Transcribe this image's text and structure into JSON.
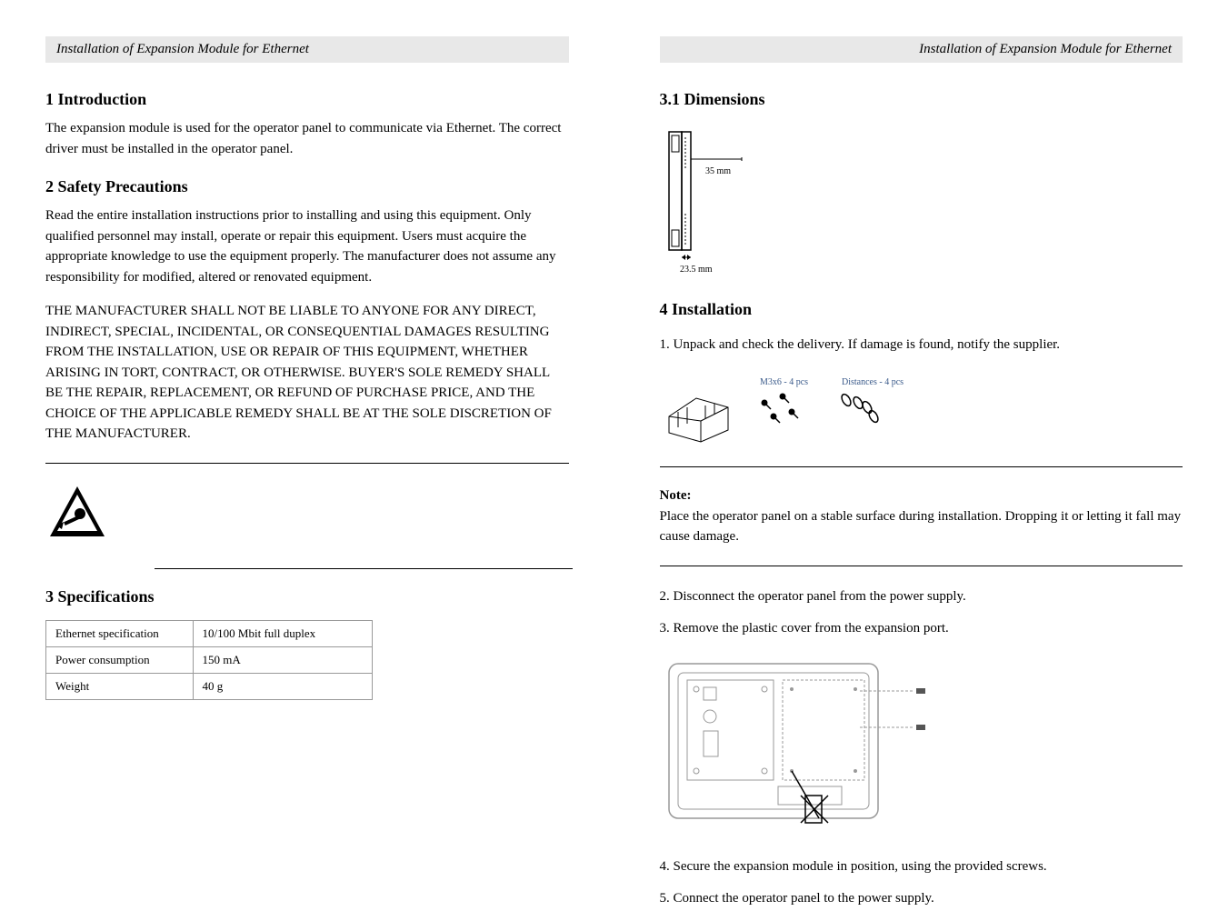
{
  "header": {
    "title": "Installation of Expansion Module for Ethernet"
  },
  "left": {
    "introTitle": "1 Introduction",
    "introText": "The expansion module is used for the operator panel to communicate via Ethernet. The correct driver must be installed in the operator panel.",
    "safetyTitle": "2 Safety Precautions",
    "safetyText": "Read the entire installation instructions prior to installing and using this equipment. Only qualified personnel may install, operate or repair this equipment. Users must acquire the appropriate knowledge to use the equipment properly. The manufacturer does not assume any responsibility for modified, altered or renovated equipment.",
    "disclaimerText": "THE MANUFACTURER SHALL NOT BE LIABLE TO ANYONE FOR ANY DIRECT, INDIRECT, SPECIAL, INCIDENTAL, OR CONSEQUENTIAL DAMAGES RESULTING FROM THE INSTALLATION, USE OR REPAIR OF THIS EQUIPMENT, WHETHER ARISING IN TORT, CONTRACT, OR OTHERWISE. BUYER'S SOLE REMEDY SHALL BE THE REPAIR, REPLACEMENT, OR REFUND OF PURCHASE PRICE, AND THE CHOICE OF THE APPLICABLE REMEDY SHALL BE AT THE SOLE DISCRETION OF THE MANUFACTURER.",
    "specTitle": "3 Specifications",
    "table": {
      "row1": {
        "label": "Ethernet specification",
        "value": "10/100 Mbit full duplex"
      },
      "row2": {
        "label": "Power consumption",
        "value": "150 mA"
      },
      "row3": {
        "label": "Weight",
        "value": "40 g"
      }
    }
  },
  "right": {
    "dimTitle": "3.1 Dimensions",
    "dim1": "35 mm",
    "dim2": "23.5 mm",
    "installTitle": "4 Installation",
    "step1": "1.  Unpack and check the delivery. If damage is found, notify the supplier.",
    "screwLabel": "M3x6 - 4 pcs",
    "distLabel": "Distances - 4 pcs",
    "noteTitle": "Note:",
    "noteText": "Place the operator panel on a stable surface during installation. Dropping it or letting it fall may cause damage.",
    "step2": "2.  Disconnect the operator panel from the power supply.",
    "step3": "3.  Remove the plastic cover from the expansion port.",
    "step4": "4.  Secure the expansion module in position, using the provided screws.",
    "step5": "5.  Connect the operator panel to the power supply."
  }
}
